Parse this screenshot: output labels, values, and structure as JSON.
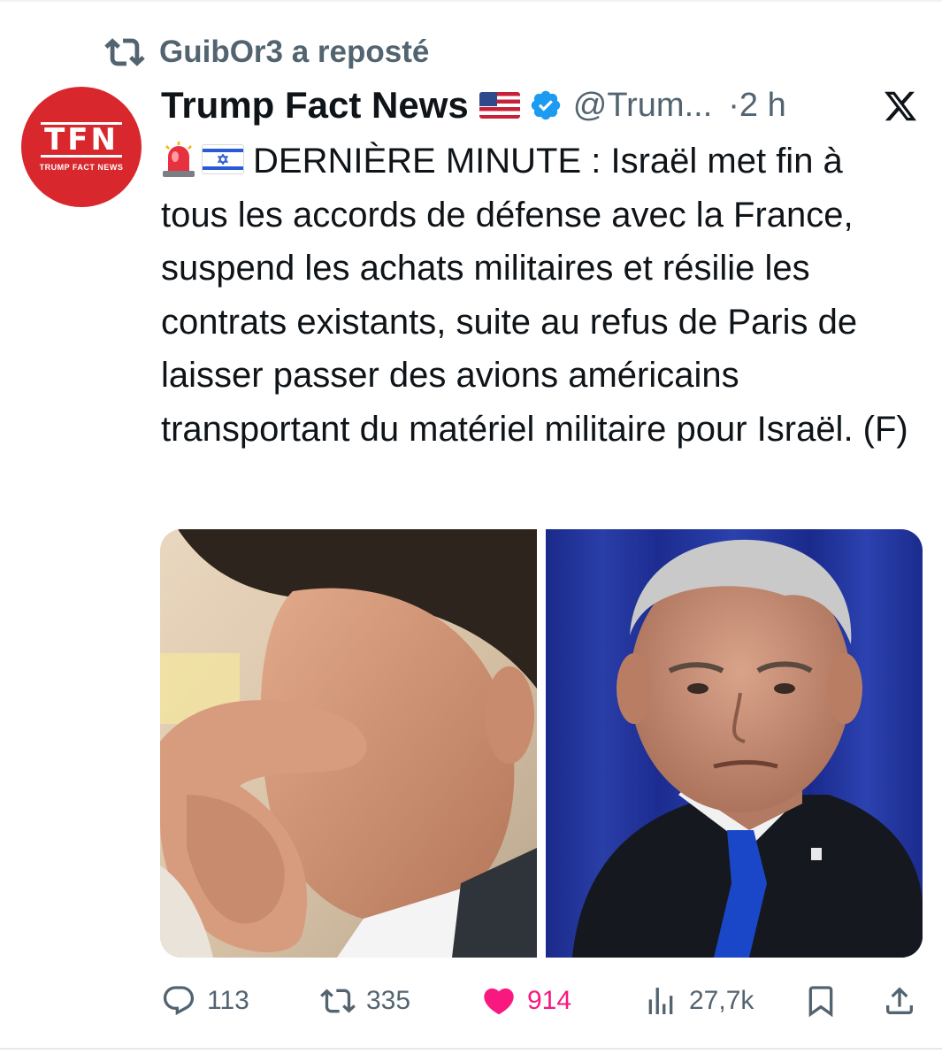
{
  "repost": {
    "icon": "repost-icon",
    "text": "GuibOr3 a reposté"
  },
  "author": {
    "avatar_text": "TFN",
    "avatar_subtext": "TRUMP FACT NEWS",
    "display_name": "Trump Fact News",
    "flag_icon": "us-flag-icon",
    "verified_icon": "verified-badge-icon",
    "handle": "@Trum...",
    "time": "·2 h"
  },
  "tweet": {
    "emoji_1": "siren-emoji",
    "emoji_2": "israel-flag-emoji",
    "text": "DERNIÈRE MINUTE : Israël met fin à tous les accords de défense avec la France, suspend les achats militaires et résilie les contrats existants, suite au refus de Paris de laisser passer des avions américains transportant du matériel militaire pour Israël. (F)"
  },
  "media": [
    {
      "name": "photo-man-hand-on-face"
    },
    {
      "name": "photo-man-blue-tie"
    }
  ],
  "actions": {
    "replies": "113",
    "reposts": "335",
    "likes": "914",
    "views": "27,7k"
  },
  "colors": {
    "secondary_text": "#536471",
    "like_pink": "#f91880",
    "verified_blue": "#1d9bf0",
    "avatar_red": "#d8272d"
  }
}
